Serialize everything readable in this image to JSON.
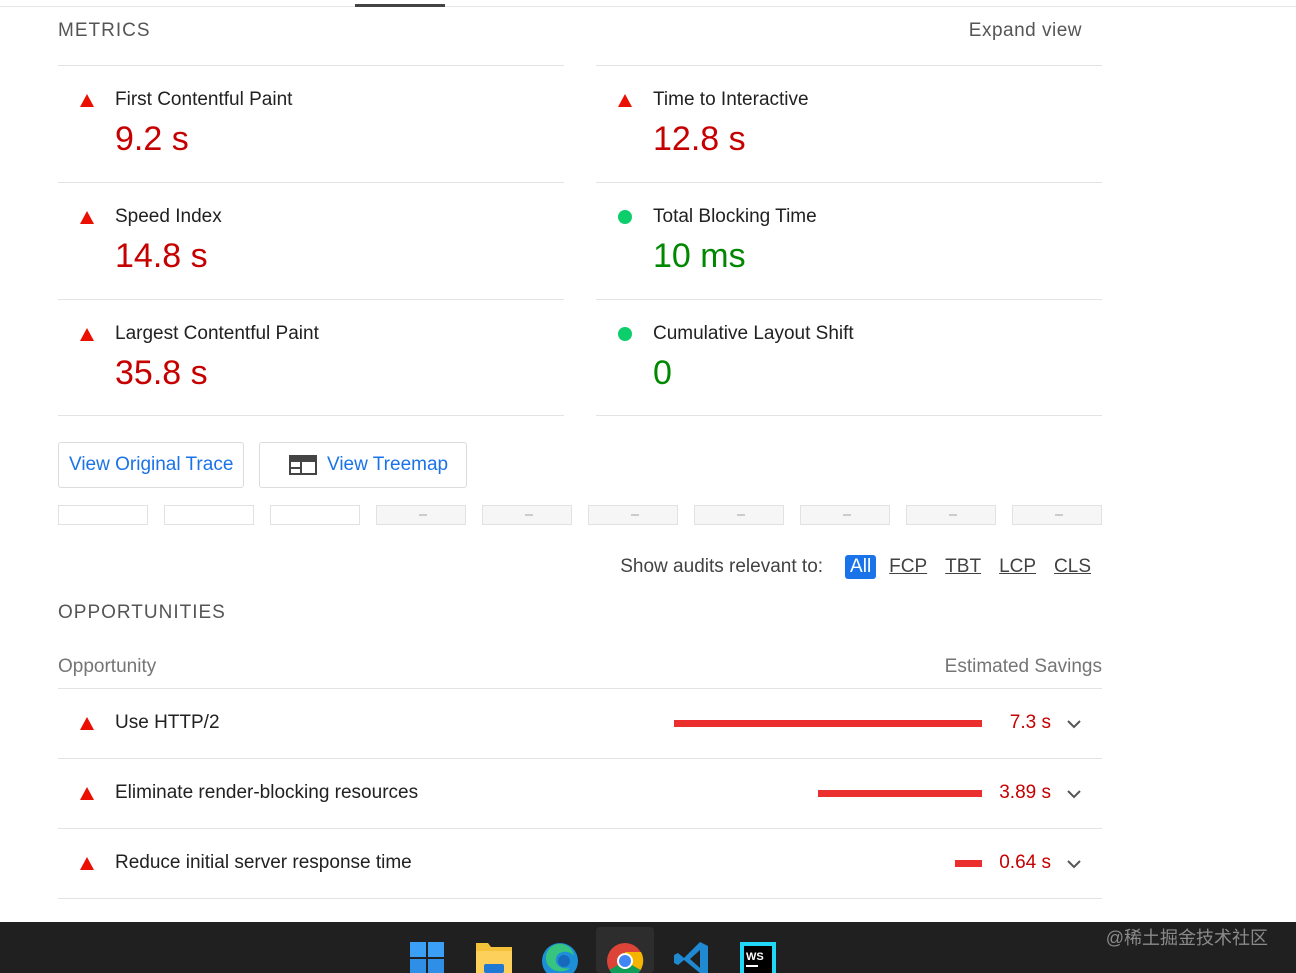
{
  "metrics": {
    "title": "METRICS",
    "expand_label": "Expand view",
    "items": [
      {
        "label": "First Contentful Paint",
        "value": "9.2 s",
        "status": "fail"
      },
      {
        "label": "Time to Interactive",
        "value": "12.8 s",
        "status": "fail"
      },
      {
        "label": "Speed Index",
        "value": "14.8 s",
        "status": "fail"
      },
      {
        "label": "Total Blocking Time",
        "value": "10 ms",
        "status": "pass"
      },
      {
        "label": "Largest Contentful Paint",
        "value": "35.8 s",
        "status": "fail"
      },
      {
        "label": "Cumulative Layout Shift",
        "value": "0",
        "status": "pass"
      }
    ]
  },
  "buttons": {
    "trace": "View Original Trace",
    "treemap": "View Treemap"
  },
  "filter": {
    "label": "Show audits relevant to:",
    "chips": [
      "All",
      "FCP",
      "TBT",
      "LCP",
      "CLS"
    ],
    "active": "All"
  },
  "opportunities": {
    "title": "OPPORTUNITIES",
    "col_opportunity": "Opportunity",
    "col_savings": "Estimated Savings",
    "rows": [
      {
        "title": "Use HTTP/2",
        "savings": "7.3 s",
        "savings_seconds": 7.3
      },
      {
        "title": "Eliminate render-blocking resources",
        "savings": "3.89 s",
        "savings_seconds": 3.89
      },
      {
        "title": "Reduce initial server response time",
        "savings": "0.64 s",
        "savings_seconds": 0.64
      }
    ]
  },
  "taskbar": {
    "icons": [
      "windows-start-icon",
      "file-explorer-icon",
      "edge-browser-icon",
      "chrome-browser-icon",
      "vscode-icon",
      "webstorm-icon"
    ],
    "watermark": "@稀土掘金技术社区"
  },
  "colors": {
    "fail": "#c60000",
    "pass": "#008800",
    "accent": "#1a73e8",
    "bar": "#eb2f2f"
  }
}
